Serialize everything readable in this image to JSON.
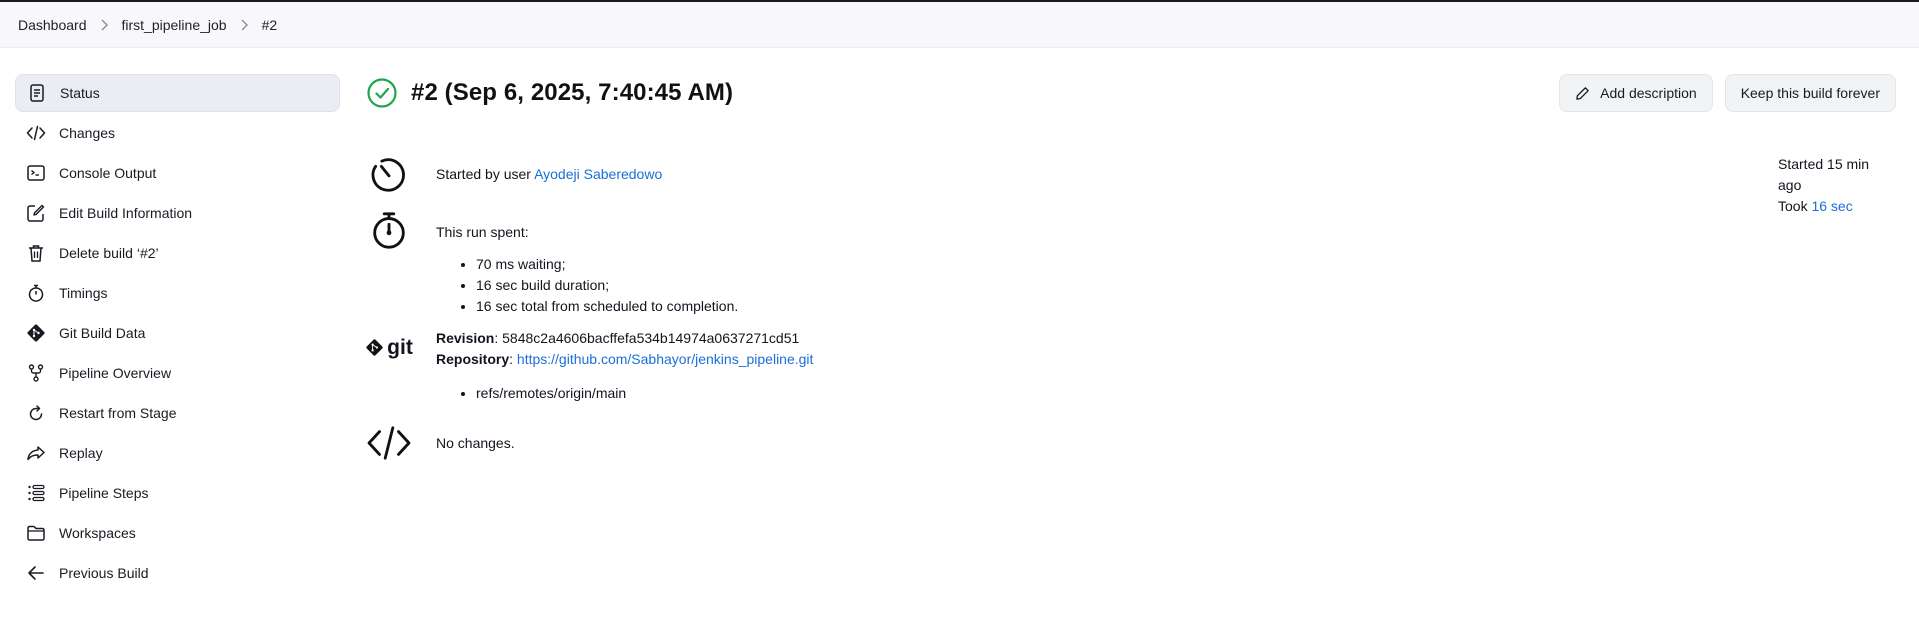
{
  "breadcrumb": {
    "items": [
      "Dashboard",
      "first_pipeline_job",
      "#2"
    ]
  },
  "sidebar": {
    "items": [
      {
        "label": "Status",
        "icon": "document-icon",
        "active": true
      },
      {
        "label": "Changes",
        "icon": "code-icon"
      },
      {
        "label": "Console Output",
        "icon": "terminal-icon"
      },
      {
        "label": "Edit Build Information",
        "icon": "edit-icon"
      },
      {
        "label": "Delete build ‘#2’",
        "icon": "trash-icon"
      },
      {
        "label": "Timings",
        "icon": "stopwatch-icon"
      },
      {
        "label": "Git Build Data",
        "icon": "git-icon"
      },
      {
        "label": "Pipeline Overview",
        "icon": "branch-icon"
      },
      {
        "label": "Restart from Stage",
        "icon": "restart-icon"
      },
      {
        "label": "Replay",
        "icon": "replay-icon"
      },
      {
        "label": "Pipeline Steps",
        "icon": "list-icon"
      },
      {
        "label": "Workspaces",
        "icon": "folder-icon"
      },
      {
        "label": "Previous Build",
        "icon": "arrow-left-icon"
      }
    ]
  },
  "header": {
    "title": "#2 (Sep 6, 2025, 7:40:45 AM)",
    "status": "success",
    "add_description_label": "Add description",
    "keep_forever_label": "Keep this build forever"
  },
  "started": {
    "prefix": "Started by user ",
    "user": "Ayodeji Saberedowo"
  },
  "run_spent": {
    "heading": "This run spent:",
    "items": [
      "70 ms waiting;",
      "16 sec build duration;",
      "16 sec total from scheduled to completion."
    ]
  },
  "git": {
    "logo_text": "git",
    "revision_label": "Revision",
    "revision": "5848c2a4606bacffefa534b14974a0637271cd51",
    "repository_label": "Repository",
    "repository": "https://github.com/Sabhayor/jenkins_pipeline.git",
    "branches": [
      "refs/remotes/origin/main"
    ]
  },
  "changes": {
    "text": "No changes."
  },
  "info": {
    "started": "Started 15 min ago",
    "took_prefix": "Took ",
    "took": "16 sec"
  },
  "colors": {
    "success": "#1ea64f",
    "link": "#1a6fd6",
    "active_bg": "#ebedf2"
  }
}
